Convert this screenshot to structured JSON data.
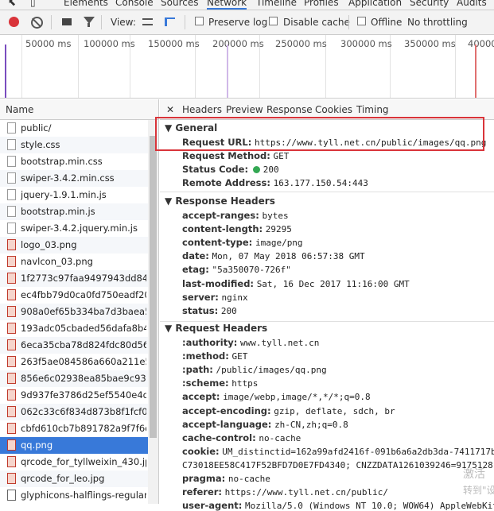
{
  "devtools_tabs": [
    "Elements",
    "Console",
    "Sources",
    "Network",
    "Timeline",
    "Profiles",
    "Application",
    "Security",
    "Audits"
  ],
  "toolbar": {
    "view_label": "View:",
    "preserve_log": "Preserve log",
    "disable_cache": "Disable cache",
    "offline": "Offline",
    "throttling": "No throttling"
  },
  "overview": {
    "ticks": [
      "50000 ms",
      "100000 ms",
      "150000 ms",
      "200000 ms",
      "250000 ms",
      "300000 ms",
      "350000 ms",
      "40000"
    ]
  },
  "name_column": "Name",
  "files": [
    {
      "name": "public/",
      "icon": "document-icon"
    },
    {
      "name": "style.css",
      "icon": "css-icon"
    },
    {
      "name": "bootstrap.min.css",
      "icon": "css-icon"
    },
    {
      "name": "swiper-3.4.2.min.css",
      "icon": "css-icon"
    },
    {
      "name": "jquery-1.9.1.min.js",
      "icon": "js-icon"
    },
    {
      "name": "bootstrap.min.js",
      "icon": "js-icon"
    },
    {
      "name": "swiper-3.4.2.jquery.min.js",
      "icon": "js-icon"
    },
    {
      "name": "logo_03.png",
      "icon": "image-icon"
    },
    {
      "name": "navlcon_03.png",
      "icon": "image-icon"
    },
    {
      "name": "1f2773c97faa9497943dd84...",
      "icon": "image-icon"
    },
    {
      "name": "ec4fbb79d0ca0fd750eadf20...",
      "icon": "image-icon"
    },
    {
      "name": "908a0ef65b334ba7d3baea5...",
      "icon": "image-icon"
    },
    {
      "name": "193adc05cbaded56dafa8b4...",
      "icon": "image-icon"
    },
    {
      "name": "6eca35cba78d824fdc80d56...",
      "icon": "image-icon"
    },
    {
      "name": "263f5ae084586a660a211e5...",
      "icon": "image-icon"
    },
    {
      "name": "856e6c02938ea85bae9c93e...",
      "icon": "image-icon"
    },
    {
      "name": "9d937fe3786d25ef5540e4d...",
      "icon": "image-icon"
    },
    {
      "name": "062c33c6f834d873b8f1fcf0...",
      "icon": "image-icon"
    },
    {
      "name": "cbfd610cb7b891782a9f7f6c...",
      "icon": "image-icon"
    },
    {
      "name": "qq.png",
      "icon": "image-icon"
    },
    {
      "name": "qrcode_for_tyllweixin_430.jpg",
      "icon": "image-icon"
    },
    {
      "name": "qrcode_for_leo.jpg",
      "icon": "image-icon"
    },
    {
      "name": "glyphicons-halflings-regular...",
      "icon": "font-icon"
    }
  ],
  "detail_tabs": [
    "Headers",
    "Preview",
    "Response",
    "Cookies",
    "Timing"
  ],
  "general": {
    "title": "General",
    "rows": [
      {
        "key": "Request URL:",
        "value": "https://www.tyll.net.cn/public/images/qq.png"
      },
      {
        "key": "Request Method:",
        "value": "GET"
      },
      {
        "key": "Status Code:",
        "value": "200"
      },
      {
        "key": "Remote Address:",
        "value": "163.177.150.54:443"
      }
    ]
  },
  "response_headers": {
    "title": "Response Headers",
    "rows": [
      {
        "key": "accept-ranges:",
        "value": "bytes"
      },
      {
        "key": "content-length:",
        "value": "29295"
      },
      {
        "key": "content-type:",
        "value": "image/png"
      },
      {
        "key": "date:",
        "value": "Mon, 07 May 2018 06:57:38 GMT"
      },
      {
        "key": "etag:",
        "value": "\"5a350070-726f\""
      },
      {
        "key": "last-modified:",
        "value": "Sat, 16 Dec 2017 11:16:00 GMT"
      },
      {
        "key": "server:",
        "value": "nginx"
      },
      {
        "key": "status:",
        "value": "200"
      }
    ]
  },
  "request_headers": {
    "title": "Request Headers",
    "rows": [
      {
        "key": ":authority:",
        "value": "www.tyll.net.cn"
      },
      {
        "key": ":method:",
        "value": "GET"
      },
      {
        "key": ":path:",
        "value": "/public/images/qq.png"
      },
      {
        "key": ":scheme:",
        "value": "https"
      },
      {
        "key": "accept:",
        "value": "image/webp,image/*,*/*;q=0.8"
      },
      {
        "key": "accept-encoding:",
        "value": "gzip, deflate, sdch, br"
      },
      {
        "key": "accept-language:",
        "value": "zh-CN,zh;q=0.8"
      },
      {
        "key": "cache-control:",
        "value": "no-cache"
      },
      {
        "key": "cookie:",
        "value": "UM_distinctid=162a99afd2416f-091b6a6a2db3da-7411717b-"
      },
      {
        "key": "",
        "value": "C73018EE58C417F52BFD7D0E7FD4340; CNZZDATA1261039246=9175128"
      },
      {
        "key": "pragma:",
        "value": "no-cache"
      },
      {
        "key": "referer:",
        "value": "https://www.tyll.net.cn/public/"
      },
      {
        "key": "user-agent:",
        "value": "Mozilla/5.0 (Windows NT 10.0; WOW64) AppleWebKit/"
      }
    ]
  },
  "watermark": {
    "line1": "激活",
    "line2": "转到\"设"
  },
  "colors": {
    "accent": "#3879d9",
    "record": "#d9343a",
    "status_ok": "#34a853",
    "highlight_box": "#d9343a"
  }
}
